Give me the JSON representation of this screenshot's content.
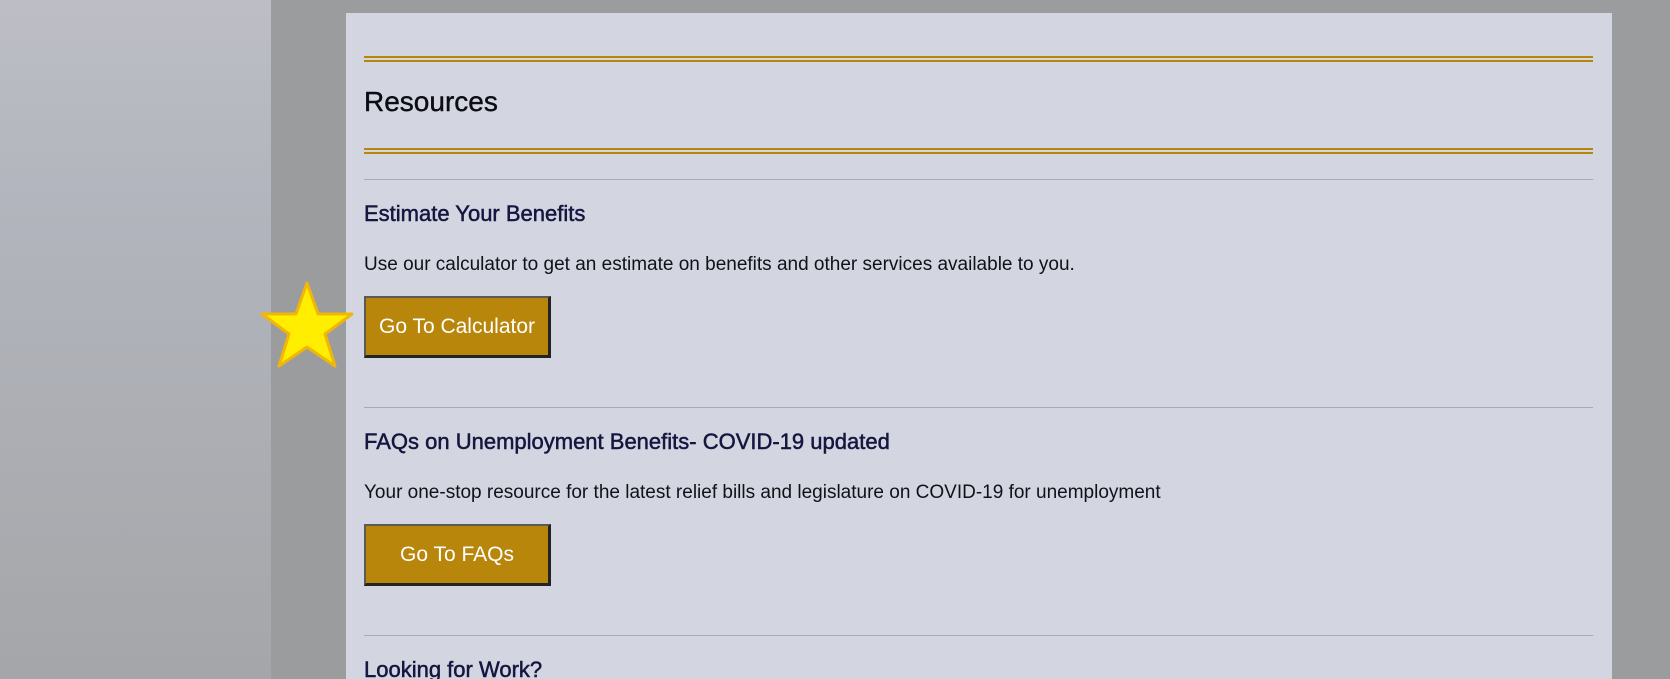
{
  "page": {
    "section_title": "Resources"
  },
  "items": [
    {
      "title": "Estimate Your Benefits",
      "description": "Use our calculator to get an estimate on benefits and other services available to you.",
      "button_label": "Go To Calculator"
    },
    {
      "title": "FAQs on Unemployment Benefits- COVID-19 updated",
      "description": "Your one-stop resource for the latest relief bills and legislature on COVID-19 for unemployment",
      "button_label": "Go To FAQs"
    },
    {
      "title": "Looking for Work?"
    }
  ],
  "colors": {
    "accent_gold": "#b8860b",
    "card_background": "#d3d5e0",
    "heading_navy": "#15163f",
    "highlight_star": "#ffee00"
  },
  "icons": {
    "highlight": "star-icon"
  }
}
